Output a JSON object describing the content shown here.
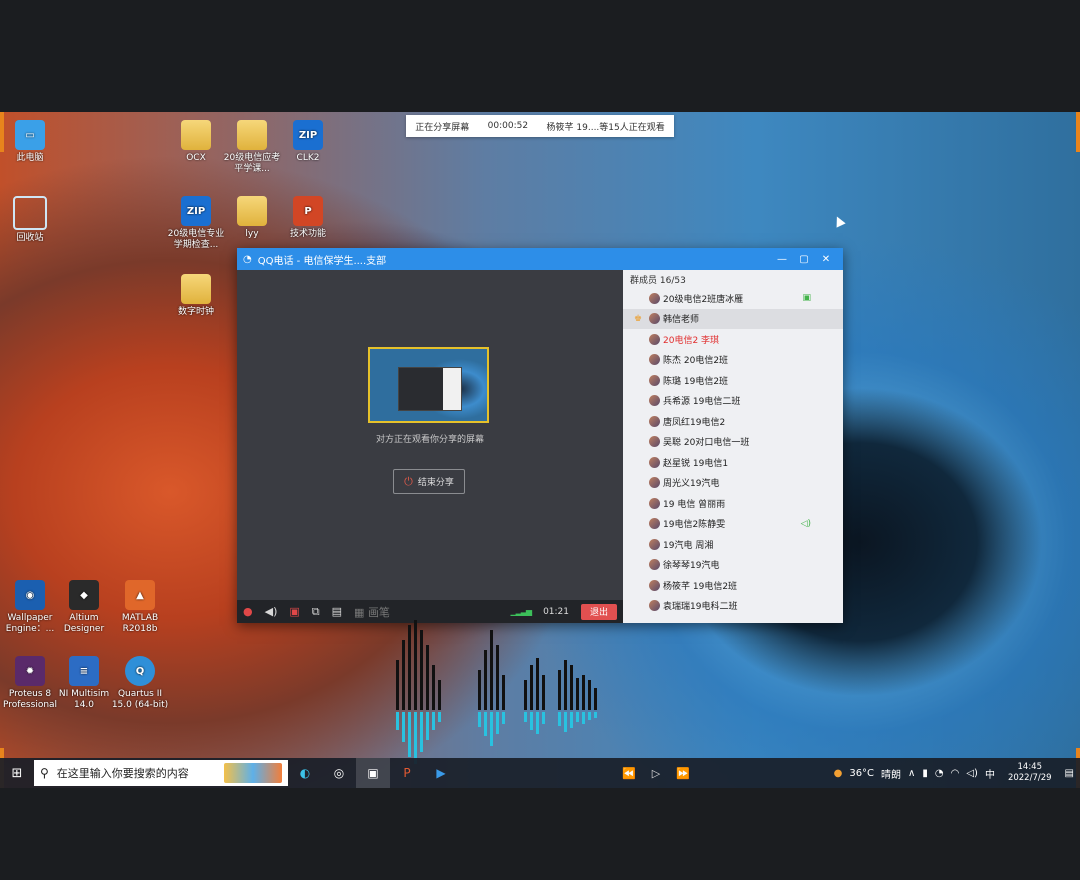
{
  "share_banner": {
    "status": "正在分享屏幕",
    "timer": "00:00:52",
    "viewers": "杨筱芊 19....等15人正在观看"
  },
  "desktop_icons": [
    {
      "label": "此电脑",
      "icon": "computer-icon"
    },
    {
      "label": "回收站",
      "icon": "recycle-bin-icon"
    },
    {
      "label": "OCX",
      "icon": "folder-icon"
    },
    {
      "label": "20级电信应考平学课...",
      "icon": "folder-icon"
    },
    {
      "label": "CLK2",
      "icon": "zip-icon"
    },
    {
      "label": "20级电信专业学期检查...",
      "icon": "zip-icon"
    },
    {
      "label": "lyy",
      "icon": "folder-icon"
    },
    {
      "label": "技术功能",
      "icon": "ppt-icon"
    },
    {
      "label": "数字时钟",
      "icon": "folder-icon"
    },
    {
      "label": "Wallpaper Engine：...",
      "icon": "wallpaper-engine-icon"
    },
    {
      "label": "Altium Designer",
      "icon": "altium-icon"
    },
    {
      "label": "MATLAB R2018b",
      "icon": "matlab-icon"
    },
    {
      "label": "Proteus 8 Professional",
      "icon": "proteus-icon"
    },
    {
      "label": "NI Multisim 14.0",
      "icon": "multisim-icon"
    },
    {
      "label": "Quartus II 15.0 (64-bit)",
      "icon": "quartus-icon"
    }
  ],
  "qq_window": {
    "title": "QQ电话 - 电信保学生....支部",
    "preview_hint": "对方正在观看你分享的屏幕",
    "stop_share_label": "结束分享",
    "toolbar_text": "画笔",
    "call_time": "01:21",
    "exit_label": "退出",
    "members_header": "群成员 16/53",
    "members": [
      {
        "name": "20级电信2班唐冰雁",
        "style": "normal",
        "mic": true
      },
      {
        "name": "韩信老师",
        "style": "host",
        "mic": false
      },
      {
        "name": "20电信2 李琪",
        "style": "red",
        "mic": false
      },
      {
        "name": "陈杰 20电信2班",
        "style": "normal",
        "mic": false
      },
      {
        "name": "陈璐 19电信2班",
        "style": "normal",
        "mic": false
      },
      {
        "name": "兵希源 19电信二班",
        "style": "normal",
        "mic": false
      },
      {
        "name": "唐凤红19电信2",
        "style": "normal",
        "mic": false
      },
      {
        "name": "吴聪 20对口电信一班",
        "style": "normal",
        "mic": false
      },
      {
        "name": "赵星锐 19电信1",
        "style": "normal",
        "mic": false
      },
      {
        "name": "周光义19汽电",
        "style": "normal",
        "mic": false
      },
      {
        "name": "19 电信 曾丽雨",
        "style": "normal",
        "mic": false
      },
      {
        "name": "19电信2陈静雯",
        "style": "normal",
        "mic": true
      },
      {
        "name": "19汽电 周湘",
        "style": "normal",
        "mic": false
      },
      {
        "name": "徐琴琴19汽电",
        "style": "normal",
        "mic": false
      },
      {
        "name": "杨筱芊 19电信2班",
        "style": "normal",
        "mic": false
      },
      {
        "name": "袁瑞瑞19电科二班",
        "style": "normal",
        "mic": false
      }
    ]
  },
  "taskbar": {
    "search_placeholder": "在这里输入你要搜索的内容",
    "weather_temp": "36°C",
    "weather_desc": "晴朗",
    "ime": "中",
    "time": "14:45",
    "date": "2022/7/29"
  },
  "colors": {
    "accent": "#2d8ee8",
    "exit": "#e25050",
    "share_border": "#e5c12a",
    "corner": "#e8841c"
  }
}
